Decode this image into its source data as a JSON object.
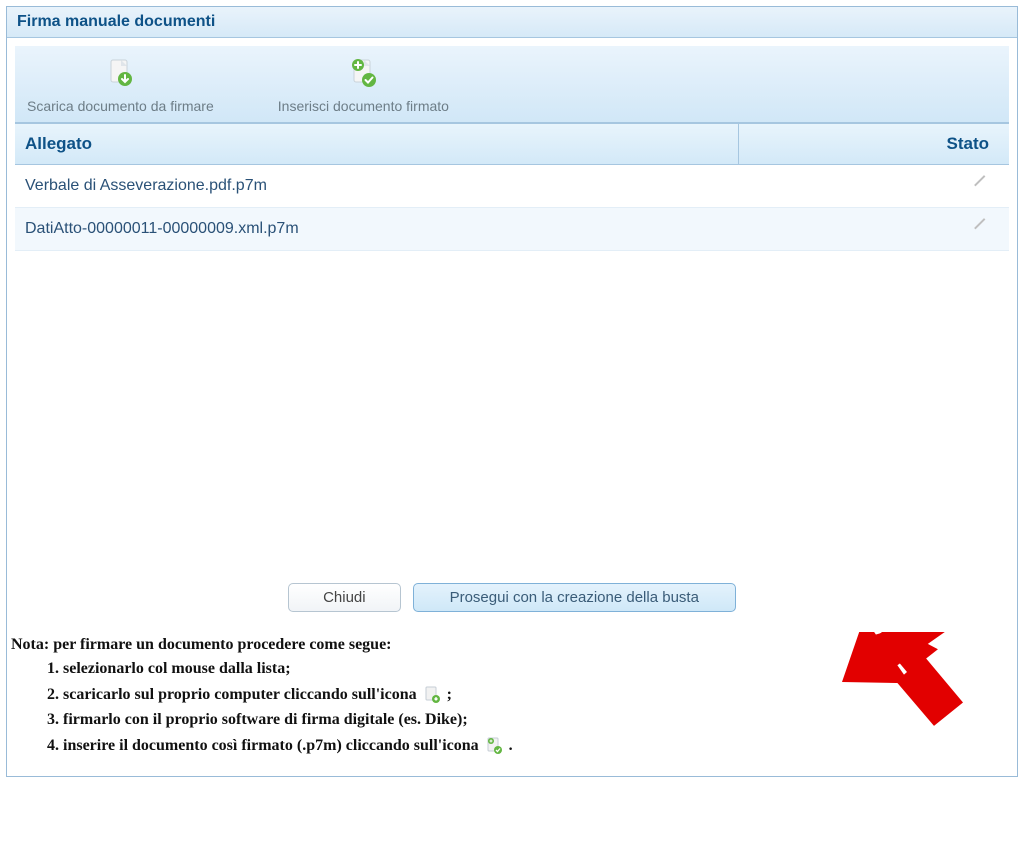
{
  "dialog": {
    "title": "Firma manuale documenti"
  },
  "toolbar": {
    "download": {
      "label": "Scarica documento da firmare"
    },
    "upload": {
      "label": "Inserisci documento firmato"
    }
  },
  "table": {
    "headers": {
      "allegato": "Allegato",
      "stato": "Stato"
    },
    "rows": [
      {
        "allegato": "Verbale di Asseverazione.pdf.p7m"
      },
      {
        "allegato": "DatiAtto-00000011-00000009.xml.p7m"
      }
    ]
  },
  "buttons": {
    "close": "Chiudi",
    "proceed": "Prosegui con la creazione della busta"
  },
  "note": {
    "heading": "Nota: per firmare un documento procedere come segue:",
    "step1": "selezionarlo col mouse dalla lista;",
    "step2a": "scaricarlo sul proprio computer cliccando sull'icona ",
    "step2b": " ;",
    "step3": "firmarlo con il proprio software di firma digitale (es. Dike);",
    "step4a": "inserire il documento così firmato (.p7m) cliccando sull'icona ",
    "step4b": " ."
  }
}
